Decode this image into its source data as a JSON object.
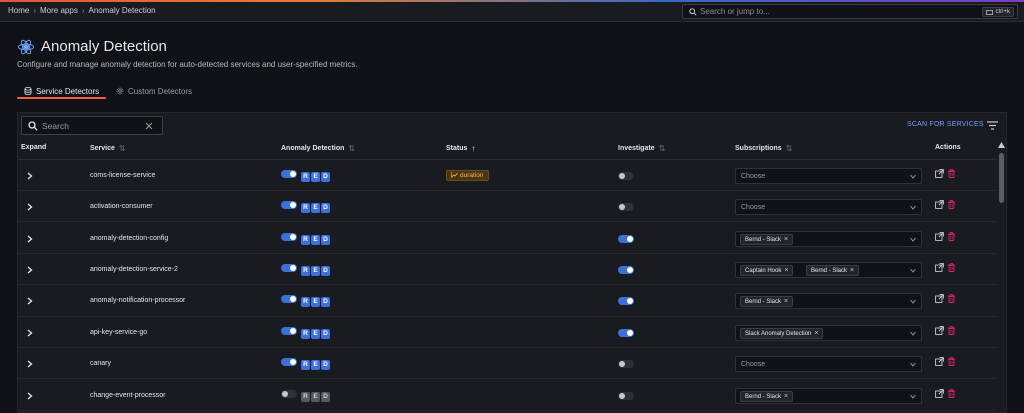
{
  "breadcrumb": {
    "home": "Home",
    "more_apps": "More apps",
    "current": "Anomaly Detection"
  },
  "search_jump": {
    "placeholder": "Search or jump to...",
    "shortcut": "ctrl+k"
  },
  "page": {
    "title": "Anomaly Detection",
    "subtitle": "Configure and manage anomaly detection for auto-detected services and user-specified metrics."
  },
  "tabs": [
    {
      "label": "Service Detectors",
      "active": true,
      "icon": "database-icon"
    },
    {
      "label": "Custom Detectors",
      "active": false,
      "icon": "gear-icon"
    }
  ],
  "toolbar": {
    "search_placeholder": "Search",
    "scan_label": "SCAN FOR SERVICES"
  },
  "columns": {
    "expand": "Expand",
    "service": "Service",
    "anomaly_detection": "Anomaly Detection",
    "status": "Status",
    "investigate": "Investigate",
    "subscriptions": "Subscriptions",
    "actions": "Actions"
  },
  "red_letters": [
    "R",
    "E",
    "D"
  ],
  "select_placeholder": "Choose",
  "rows": [
    {
      "service": "coms-license-service",
      "anomaly": true,
      "status": "duration",
      "investigate": false,
      "subscriptions": []
    },
    {
      "service": "activation-consumer",
      "anomaly": true,
      "status": "",
      "investigate": false,
      "subscriptions": []
    },
    {
      "service": "anomaly-detection-config",
      "anomaly": true,
      "status": "",
      "investigate": true,
      "subscriptions": [
        "Bernd - Slack"
      ]
    },
    {
      "service": "anomaly-detection-service-2",
      "anomaly": true,
      "status": "",
      "investigate": true,
      "subscriptions": [
        "Captain Hook",
        "Bernd - Slack"
      ]
    },
    {
      "service": "anomaly-notification-processor",
      "anomaly": true,
      "status": "",
      "investigate": true,
      "subscriptions": [
        "Bernd - Slack"
      ]
    },
    {
      "service": "api-key-service-go",
      "anomaly": true,
      "status": "",
      "investigate": true,
      "subscriptions": [
        "Slack Anomaly Detection"
      ]
    },
    {
      "service": "canary",
      "anomaly": true,
      "status": "",
      "investigate": false,
      "subscriptions": []
    },
    {
      "service": "change-event-processor",
      "anomaly": false,
      "status": "",
      "investigate": false,
      "subscriptions": [
        "Bernd - Slack"
      ]
    }
  ],
  "colors": {
    "accent_orange": "#f55f3e",
    "primary_blue": "#3d71d9",
    "link_blue": "#6e9fff",
    "delete_red": "#e0226e",
    "status_warning": "#ffb357"
  }
}
